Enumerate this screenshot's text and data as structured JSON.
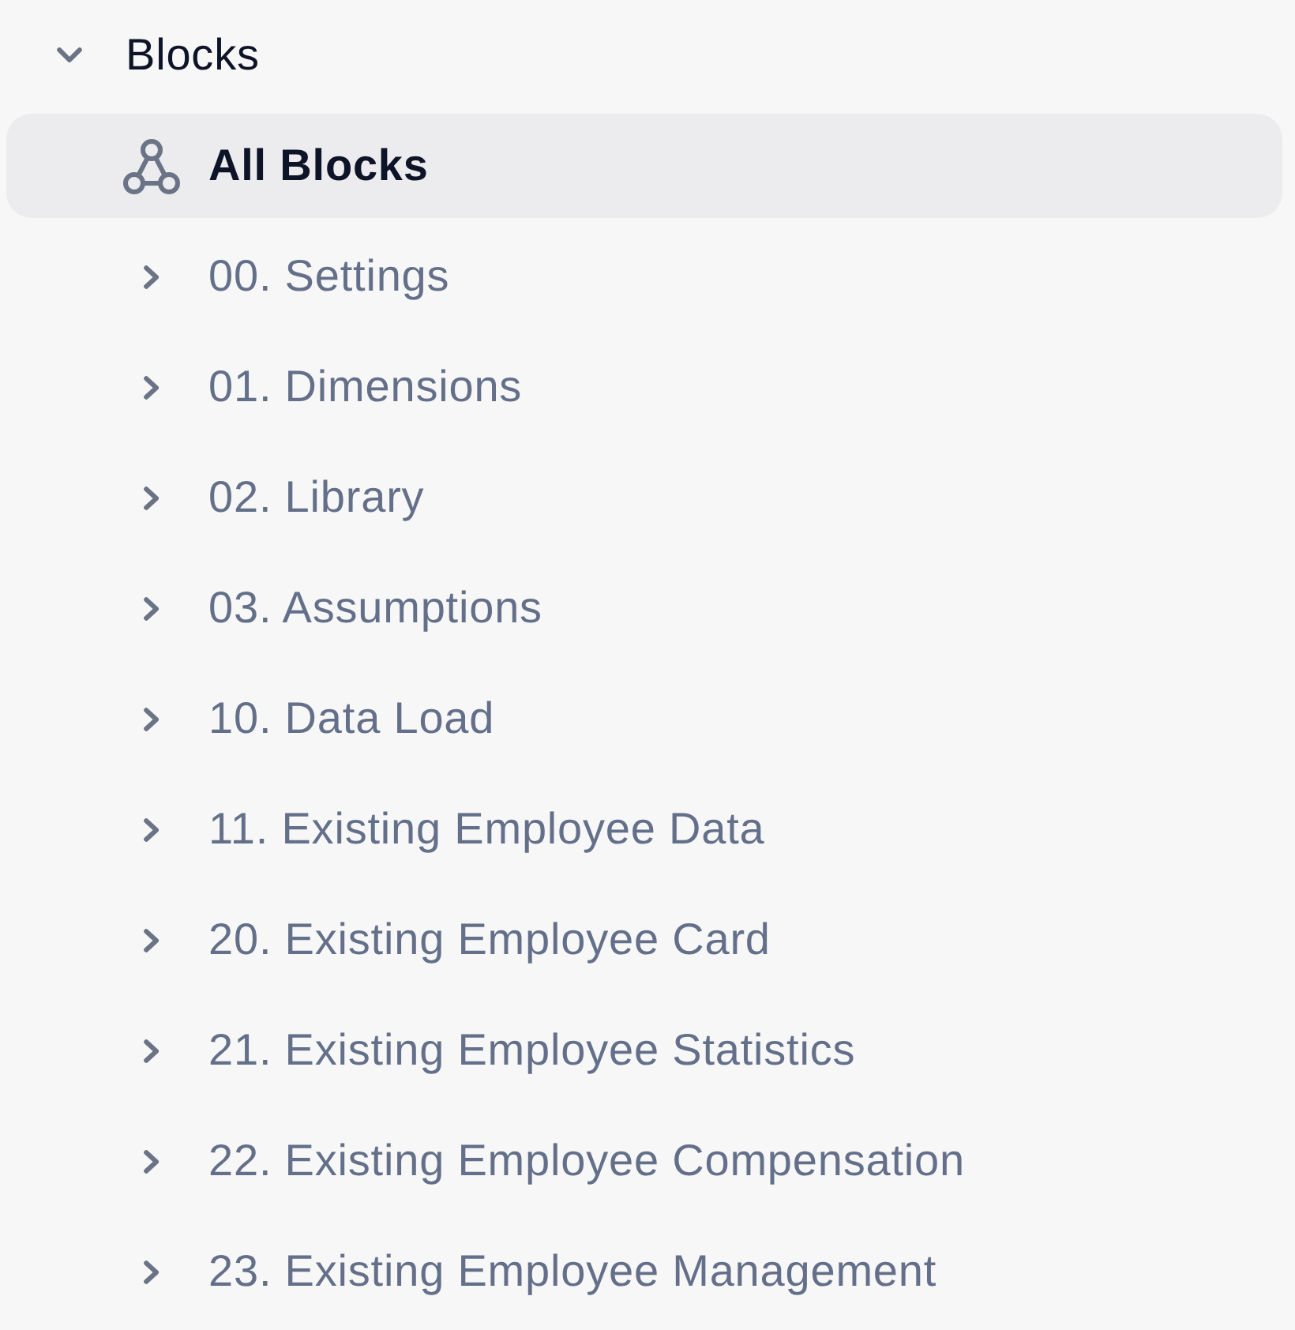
{
  "tree": {
    "label": "Blocks",
    "kind": "group",
    "expanded": true,
    "selected": false,
    "children": [
      {
        "label": "All Blocks",
        "kind": "overview",
        "selected": true
      },
      {
        "label": "00. Settings",
        "kind": "group",
        "expanded": false,
        "selected": false
      },
      {
        "label": "01. Dimensions",
        "kind": "group",
        "expanded": false,
        "selected": false
      },
      {
        "label": "02. Library",
        "kind": "group",
        "expanded": false,
        "selected": false
      },
      {
        "label": "03. Assumptions",
        "kind": "group",
        "expanded": false,
        "selected": false
      },
      {
        "label": "10. Data Load",
        "kind": "group",
        "expanded": false,
        "selected": false
      },
      {
        "label": "11. Existing Employee Data",
        "kind": "group",
        "expanded": false,
        "selected": false
      },
      {
        "label": "20. Existing Employee Card",
        "kind": "group",
        "expanded": false,
        "selected": false
      },
      {
        "label": "21. Existing Employee Statistics",
        "kind": "group",
        "expanded": false,
        "selected": false
      },
      {
        "label": "22. Existing Employee Compensation",
        "kind": "group",
        "expanded": false,
        "selected": false
      },
      {
        "label": "23. Existing Employee Management",
        "kind": "group",
        "expanded": false,
        "selected": false
      }
    ]
  }
}
